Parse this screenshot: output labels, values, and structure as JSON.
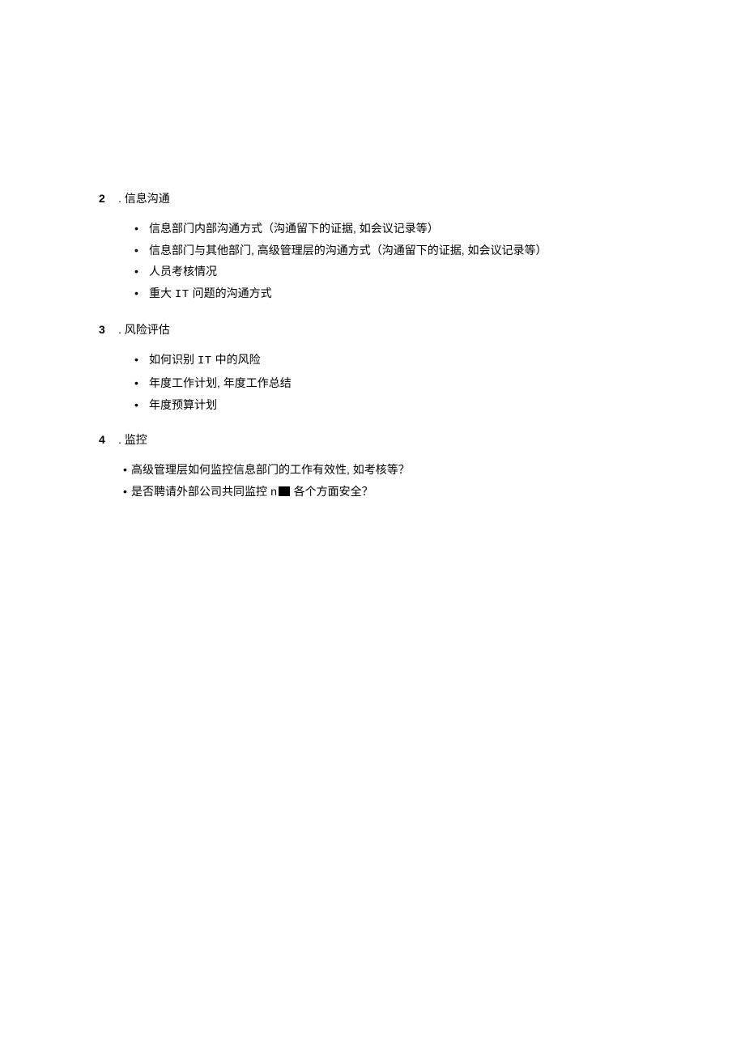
{
  "sections": [
    {
      "number": "2",
      "title": ". 信息沟通",
      "style": "normal",
      "items": [
        {
          "pre": "信息部门内部沟通方式（沟通留下的证据, 如会议记录等）"
        },
        {
          "pre": "信息部门与其他部门, 高级管理层的沟通方式（沟通留下的证据, 如会议记录等）"
        },
        {
          "pre": "人员考核情况"
        },
        {
          "pre": "重大 ",
          "mono": "IT",
          "post": " 问题的沟通方式"
        }
      ]
    },
    {
      "number": "3",
      "title": ". 风险评估",
      "style": "normal",
      "items": [
        {
          "pre": "如何识别 ",
          "mono": "IT",
          "post": " 中的风险"
        },
        {
          "pre": "年度工作计划, 年度工作总结"
        },
        {
          "pre": "年度预算计划"
        }
      ]
    },
    {
      "number": "4",
      "title": ". 监控",
      "style": "tight",
      "items": [
        {
          "pre": "高级管理层如何监控信息部门的工作有效性, 如考核等？"
        },
        {
          "pre": "是否聘请外部公司共同监控 ",
          "mono": "n",
          "redact": true,
          "post": " 各个方面安全？"
        }
      ]
    }
  ]
}
